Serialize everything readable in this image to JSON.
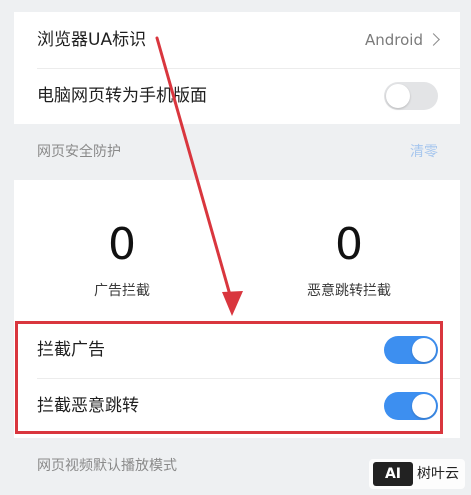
{
  "settings_top": {
    "ua_label": "浏览器UA标识",
    "ua_value": "Android",
    "desktop_to_mobile_label": "电脑网页转为手机版面",
    "desktop_to_mobile_enabled": false
  },
  "security_section": {
    "title": "网页安全防护",
    "clear_label": "清零",
    "stats": [
      {
        "value": "0",
        "caption": "广告拦截"
      },
      {
        "value": "0",
        "caption": "恶意跳转拦截"
      }
    ],
    "block_ads_label": "拦截广告",
    "block_ads_enabled": true,
    "block_malicious_redirect_label": "拦截恶意跳转",
    "block_malicious_redirect_enabled": true
  },
  "video_section": {
    "title": "网页视频默认播放模式"
  },
  "watermark": {
    "badge": "AI",
    "name": "树叶云"
  },
  "colors": {
    "accent": "#3d8ff0",
    "annotation": "#d9363e",
    "background": "#eef0f2"
  }
}
